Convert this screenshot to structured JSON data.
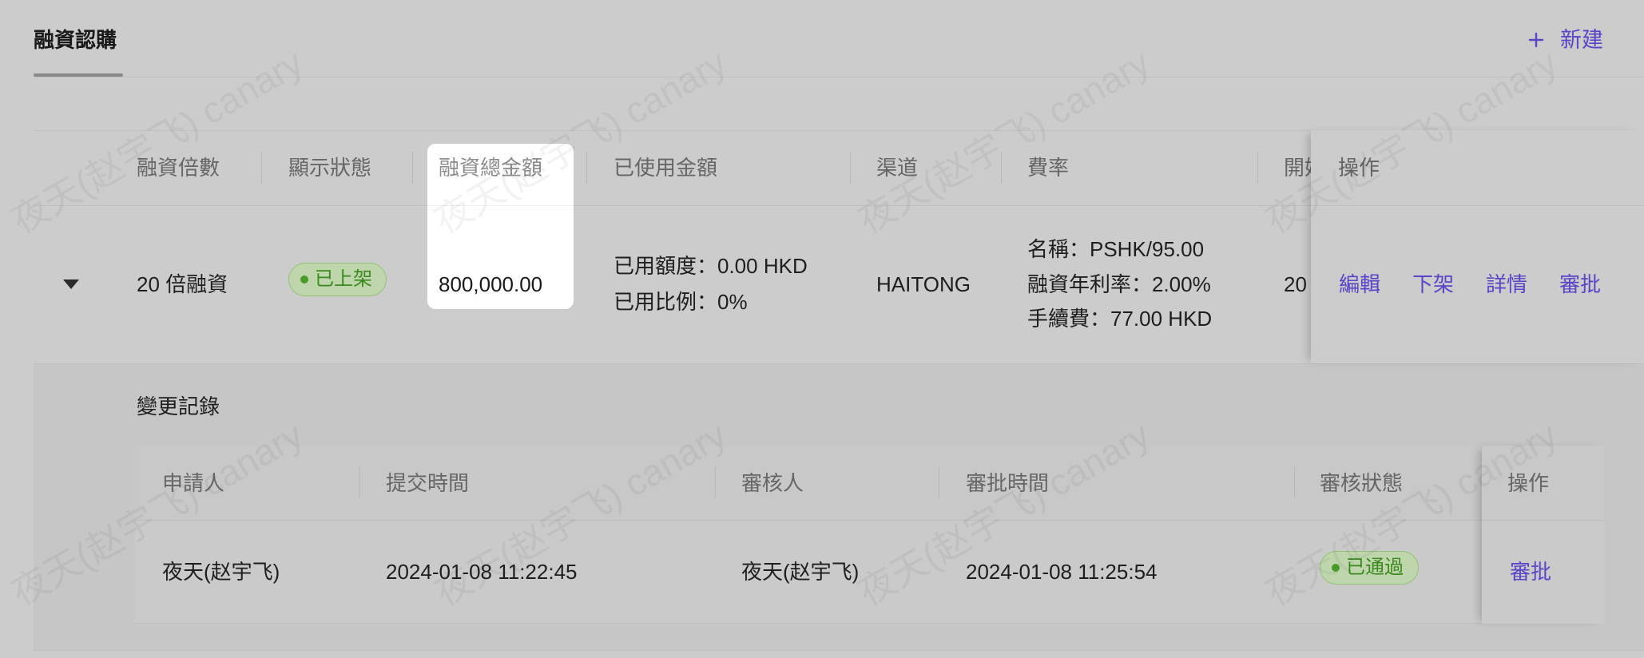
{
  "tabs": {
    "active_label": "融資認購"
  },
  "toolbar": {
    "new_icon": "plus-icon",
    "new_label": "新建"
  },
  "table": {
    "columns": [
      "融資倍數",
      "顯示狀態",
      "融資總金額",
      "已使用金額",
      "渠道",
      "費率",
      "開始",
      "操作"
    ],
    "rows": [
      {
        "expand_icon": "caret-down-icon",
        "multiple": "20 倍融資",
        "status": "已上架",
        "total_amount": "800,000.00",
        "used_amount": "已用額度：0.00 HKD",
        "used_ratio": "已用比例：0%",
        "channel": "HAITONG",
        "fee": [
          "名稱：PSHK/95.00",
          "融資年利率：2.00%",
          "手續費：77.00 HKD"
        ],
        "start": "20",
        "actions": [
          "編輯",
          "下架",
          "詳情",
          "審批"
        ]
      }
    ]
  },
  "change_log": {
    "title": "變更記錄",
    "columns": [
      "申請人",
      "提交時間",
      "審核人",
      "審批時間",
      "審核狀態",
      "操作"
    ],
    "rows": [
      {
        "applicant": "夜天(赵宇飞)",
        "submitted_at": "2024-01-08 11:22:45",
        "reviewer": "夜天(赵宇飞)",
        "approved_at": "2024-01-08 11:25:54",
        "status": "已通過",
        "action": "審批"
      }
    ]
  },
  "colors": {
    "page_overlay": "#cccccc",
    "link": "#5a44c8",
    "status_green": "#3b8a1f",
    "highlight": "#ffffff"
  },
  "watermark": "夜天(赵宇飞) canary"
}
